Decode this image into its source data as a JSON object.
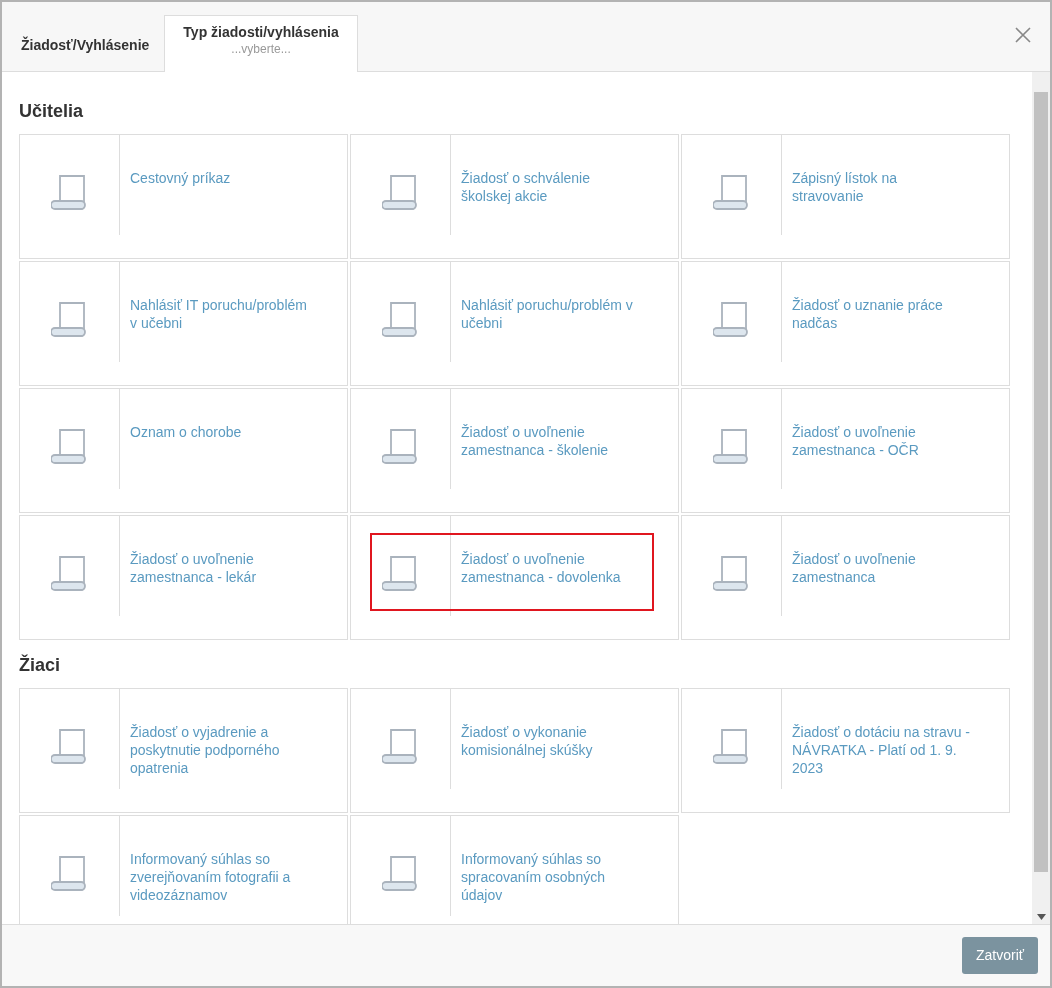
{
  "tabs": [
    {
      "label": "Žiadosť/Vyhlásenie",
      "selected": false
    },
    {
      "label": "Typ žiadosti/vyhlásenia",
      "sublabel": "...vyberte...",
      "selected": true
    }
  ],
  "sections": [
    {
      "title": "Učitelia",
      "items": [
        {
          "label": "Cestovný príkaz",
          "highlighted": false
        },
        {
          "label": "Žiadosť o schválenie školskej akcie",
          "highlighted": false
        },
        {
          "label": "Zápisný lístok na stravovanie",
          "highlighted": false
        },
        {
          "label": "Nahlásiť IT poruchu/problém v učebni",
          "highlighted": false
        },
        {
          "label": "Nahlásiť poruchu/problém v učebni",
          "highlighted": false
        },
        {
          "label": "Žiadosť o uznanie práce nadčas",
          "highlighted": false
        },
        {
          "label": "Oznam o chorobe",
          "highlighted": false
        },
        {
          "label": "Žiadosť o uvoľnenie zamestnanca - školenie",
          "highlighted": false
        },
        {
          "label": "Žiadosť o uvoľnenie zamestnanca - OČR",
          "highlighted": false
        },
        {
          "label": "Žiadosť o uvoľnenie zamestnanca - lekár",
          "highlighted": false
        },
        {
          "label": "Žiadosť o uvoľnenie zamestnanca - dovolenka",
          "highlighted": true
        },
        {
          "label": "Žiadosť o uvoľnenie zamestnanca",
          "highlighted": false
        }
      ]
    },
    {
      "title": "Žiaci",
      "items": [
        {
          "label": "Žiadosť o vyjadrenie a poskytnutie podporného opatrenia",
          "highlighted": false
        },
        {
          "label": "Žiadosť o vykonanie komisionálnej skúšky",
          "highlighted": false
        },
        {
          "label": "Žiadosť o dotáciu na stravu - NÁVRATKA - Platí od 1. 9. 2023",
          "highlighted": false
        },
        {
          "label": "Informovaný súhlas so zverejňovaním fotografii a videozáznamov",
          "highlighted": false
        },
        {
          "label": "Informovaný súhlas so spracovaním osobných údajov",
          "highlighted": false
        }
      ]
    }
  ],
  "footer": {
    "button": "Zatvoriť"
  }
}
